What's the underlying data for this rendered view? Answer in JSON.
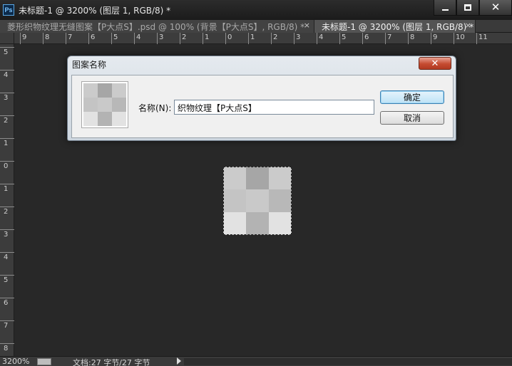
{
  "window": {
    "title": "未标题-1 @ 3200% (图层 1, RGB/8) *",
    "logo": "Ps"
  },
  "tabs": [
    {
      "label": "菱形织物纹理无缝图案【P大点S】.psd @ 100% (背景【P大点S】, RGB/8) *",
      "close": "×",
      "active": false
    },
    {
      "label": "未标题-1 @ 3200% (图层 1, RGB/8) *",
      "close": "×",
      "active": true
    }
  ],
  "ruler_top": [
    "9",
    "8",
    "7",
    "6",
    "5",
    "4",
    "3",
    "2",
    "1",
    "0",
    "1",
    "2",
    "3",
    "4",
    "5",
    "6",
    "7",
    "8",
    "9",
    "10",
    "11"
  ],
  "ruler_left": [
    "5",
    "4",
    "3",
    "2",
    "1",
    "0",
    "1",
    "2",
    "3",
    "4",
    "5",
    "6",
    "7",
    "8"
  ],
  "pattern_colors": [
    "#cbcbcb",
    "#a6a6a6",
    "#cbcbcb",
    "#c4c4c4",
    "#c9c9c9",
    "#b8b8b8",
    "#e2e2e2",
    "#b3b3b3",
    "#e2e2e2"
  ],
  "dialog": {
    "title": "图案名称",
    "close": "✕",
    "name_label": "名称(N):",
    "name_value": "织物纹理【P大点S】",
    "ok_label": "确定",
    "cancel_label": "取消"
  },
  "status": {
    "zoom": "3200%",
    "doc": "文档:27 字节/27 字节"
  }
}
